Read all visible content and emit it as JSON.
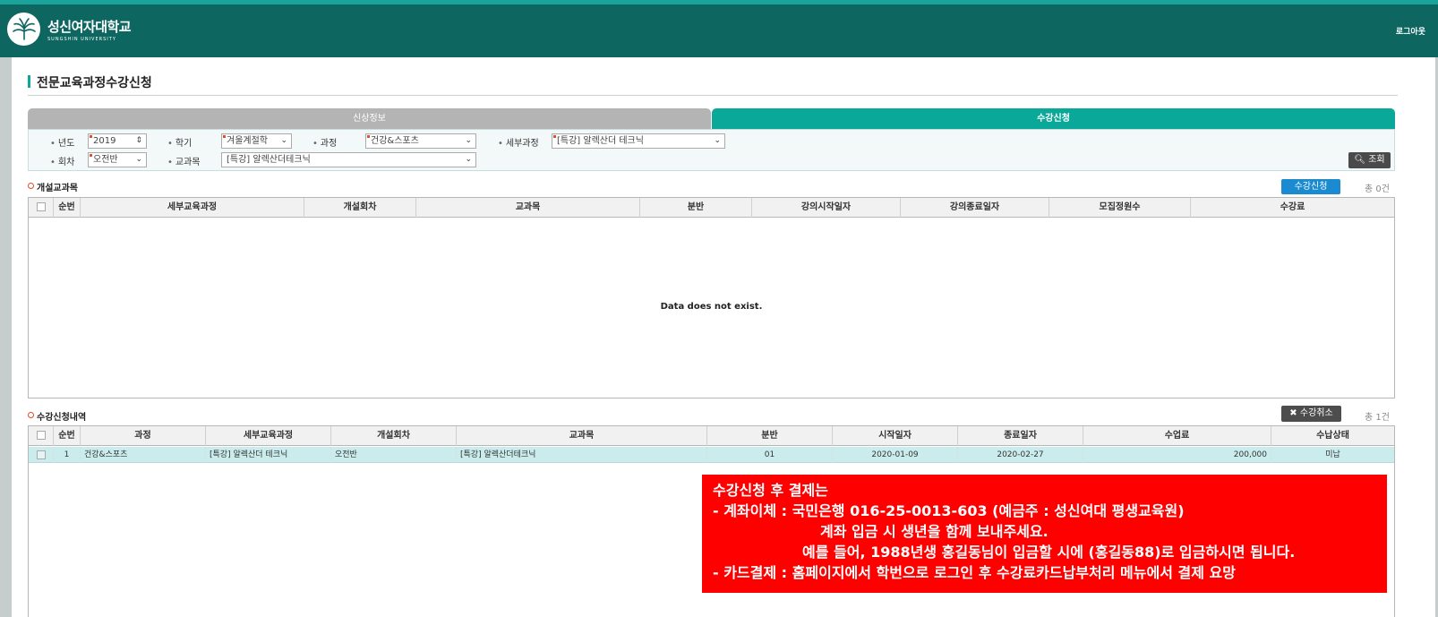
{
  "header": {
    "logo_name": "성신여자대학교",
    "logo_sub": "SUNGSHIN UNIVERSITY",
    "logout": "로그아웃"
  },
  "page_title": "전문교육과정수강신청",
  "tabs": [
    {
      "label": "신상정보"
    },
    {
      "label": "수강신청"
    }
  ],
  "filters": {
    "year_label": "년도",
    "year_value": "2019",
    "term_label": "학기",
    "term_value": "겨울계절학",
    "course_label": "과정",
    "course_value": "건강&스포츠",
    "subcourse_label": "세부과정",
    "subcourse_value": "[특강] 알렉산더 테크닉",
    "session_label": "회차",
    "session_value": "오전반",
    "subject_label": "교과목",
    "subject_value": "[특강] 알렉산더테크닉",
    "search_button": "조회"
  },
  "open_courses": {
    "title": "개설교과목",
    "apply_button": "수강신청",
    "total": "총 0건",
    "columns": [
      "순번",
      "세부교육과정",
      "개설회차",
      "교과목",
      "분반",
      "강의시작일자",
      "강의종료일자",
      "모집정원수",
      "수강료"
    ],
    "empty_message": "Data does not exist."
  },
  "applications": {
    "title": "수강신청내역",
    "cancel_button": "수강취소",
    "total": "총 1건",
    "columns": [
      "순번",
      "과정",
      "세부교육과정",
      "개설회차",
      "교과목",
      "분반",
      "시작일자",
      "종료일자",
      "수업료",
      "수납상태"
    ],
    "rows": [
      {
        "no": "1",
        "course": "건강&스포츠",
        "subcourse": "[특강] 알렉산더 테크닉",
        "session": "오전반",
        "subject": "[특강] 알렉산더테크닉",
        "section": "01",
        "start": "2020-01-09",
        "end": "2020-02-27",
        "fee": "200,000",
        "status": "미납"
      }
    ]
  },
  "notice": {
    "line1": "수강신청 후 결제는",
    "line2": "-   계좌이체 : 국민은행 016-25-0013-603 (예금주 : 성신여대 평생교육원)",
    "line3": "계좌 입금 시 생년을 함께 보내주세요.",
    "line4": "예를 들어, 1988년생 홍길동님이 입금할 시에 (홍길동88)로 입금하시면 됩니다.",
    "line5": "-   카드결제 : 홈페이지에서 학번으로 로그인 후 수강료카드납부처리 메뉴에서 결제 요망"
  },
  "colors": {
    "header": "#0d6660",
    "accent": "#0aa898",
    "notice": "#fe0000"
  }
}
